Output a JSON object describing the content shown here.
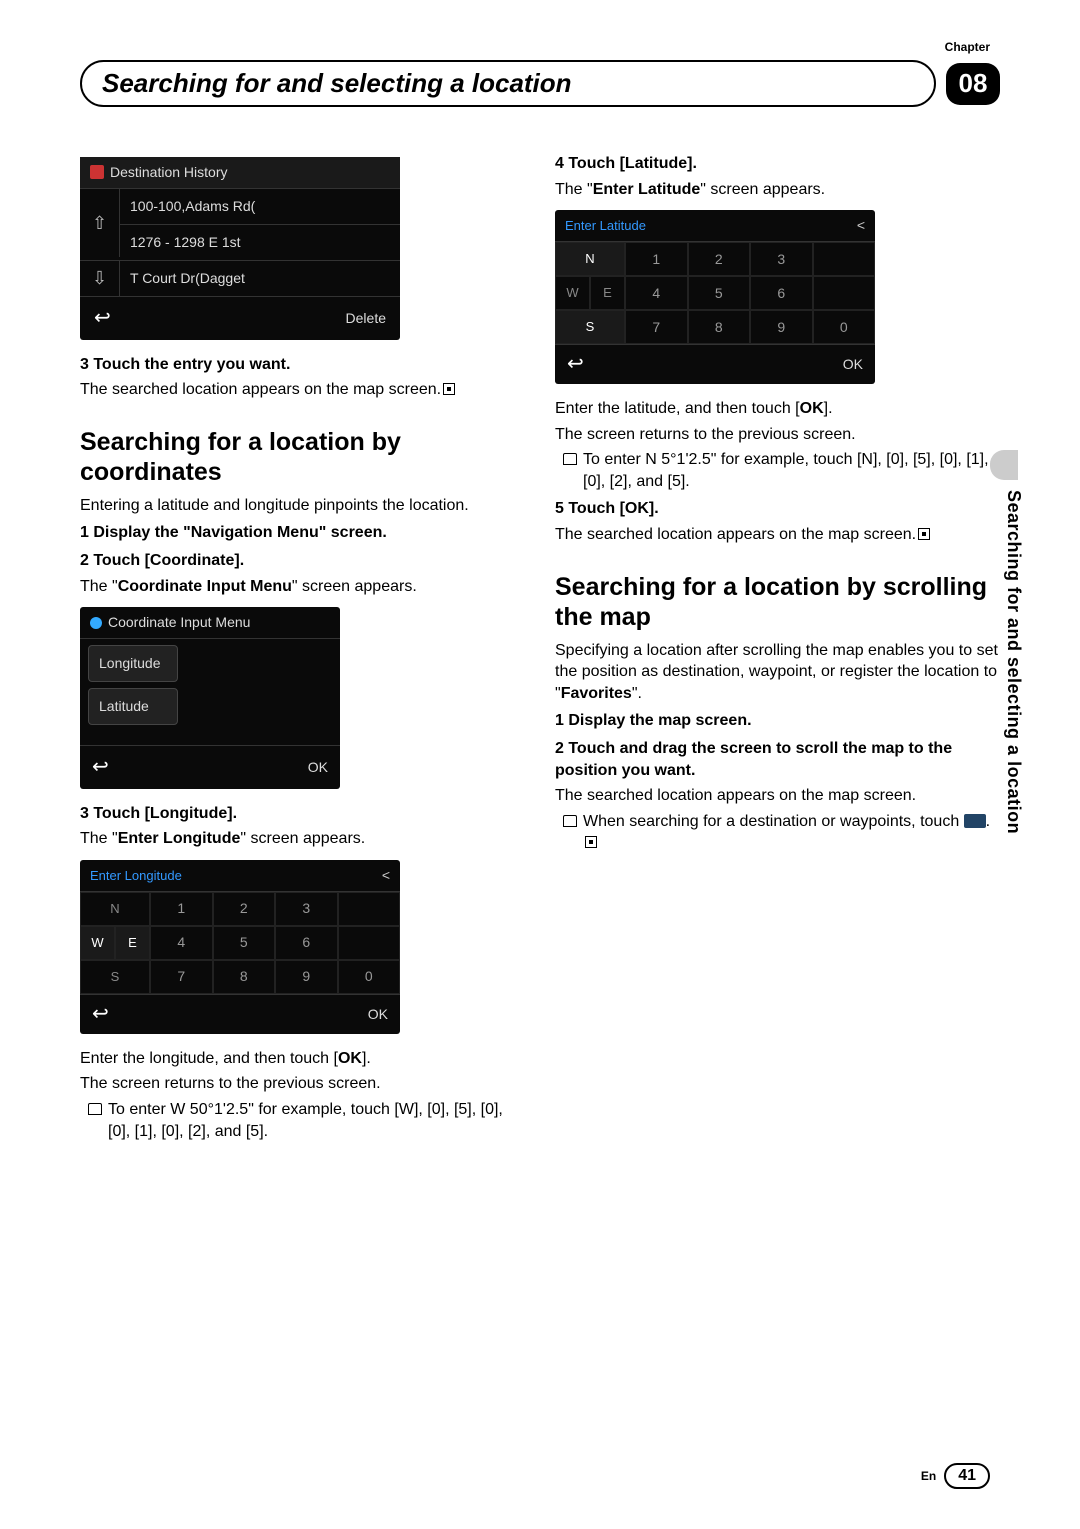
{
  "chapter_label": "Chapter",
  "chapter_number": "08",
  "page_title": "Searching for and selecting a location",
  "side_text": "Searching for and selecting a location",
  "footer": {
    "lang": "En",
    "page": "41"
  },
  "col1": {
    "fig_dh": {
      "title": "Destination History",
      "rows": [
        "100-100,Adams Rd(",
        "1276 - 1298 E 1st",
        "T Court Dr(Dagget"
      ],
      "delete": "Delete"
    },
    "s3": "3   Touch the entry you want.",
    "s3_body": "The searched location appears on the map screen.",
    "h_coords": "Searching for a location by coordinates",
    "coords_intro": "Entering a latitude and longitude pinpoints the location.",
    "c1": "1   Display the \"Navigation Menu\" screen.",
    "c2": "2   Touch [Coordinate].",
    "c2_body_a": "The \"",
    "c2_body_b": "Coordinate Input Menu",
    "c2_body_c": "\" screen appears.",
    "fig_cim": {
      "title": "Coordinate Input Menu",
      "longitude": "Longitude",
      "latitude": "Latitude",
      "ok": "OK"
    },
    "c3": "3   Touch [Longitude].",
    "c3_body_a": "The \"",
    "c3_body_b": "Enter Longitude",
    "c3_body_c": "\" screen appears.",
    "fig_lon": {
      "title": "Enter Longitude",
      "ok": "OK"
    },
    "lon_p1_a": "Enter the longitude, and then touch [",
    "lon_p1_b": "OK",
    "lon_p1_c": "].",
    "lon_p2": "The screen returns to the previous screen.",
    "lon_note": "To enter W 50°1'2.5\" for example, touch [W], [0], [5], [0], [0], [1], [0], [2], and [5]."
  },
  "col2": {
    "s4": "4   Touch [Latitude].",
    "s4_body_a": "The \"",
    "s4_body_b": "Enter Latitude",
    "s4_body_c": "\" screen appears.",
    "fig_lat": {
      "title": "Enter Latitude",
      "ok": "OK"
    },
    "lat_p1_a": "Enter the latitude, and then touch [",
    "lat_p1_b": "OK",
    "lat_p1_c": "].",
    "lat_p2": "The screen returns to the previous screen.",
    "lat_note": "To enter N 5°1'2.5\" for example, touch [N], [0], [5], [0], [1], [0], [2], and [5].",
    "s5": "5   Touch [OK].",
    "s5_body": "The searched location appears on the map screen.",
    "h_scroll": "Searching for a location by scrolling the map",
    "scroll_intro_a": "Specifying a location after scrolling the map enables you to set the position as destination, waypoint, or register the location to \"",
    "scroll_intro_b": "Favorites",
    "scroll_intro_c": "\".",
    "m1": "1   Display the map screen.",
    "m2": "2   Touch and drag the screen to scroll the map to the position you want.",
    "m2_body": "The searched location appears on the map screen.",
    "m_note_a": "When searching for a destination or waypoints, touch ",
    "m_note_b": "."
  },
  "keypad": {
    "dirs": {
      "n": "N",
      "w": "W",
      "e": "E",
      "s": "S"
    },
    "nums": [
      "1",
      "2",
      "3",
      "",
      "4",
      "5",
      "6",
      "",
      "7",
      "8",
      "9",
      "0"
    ]
  }
}
